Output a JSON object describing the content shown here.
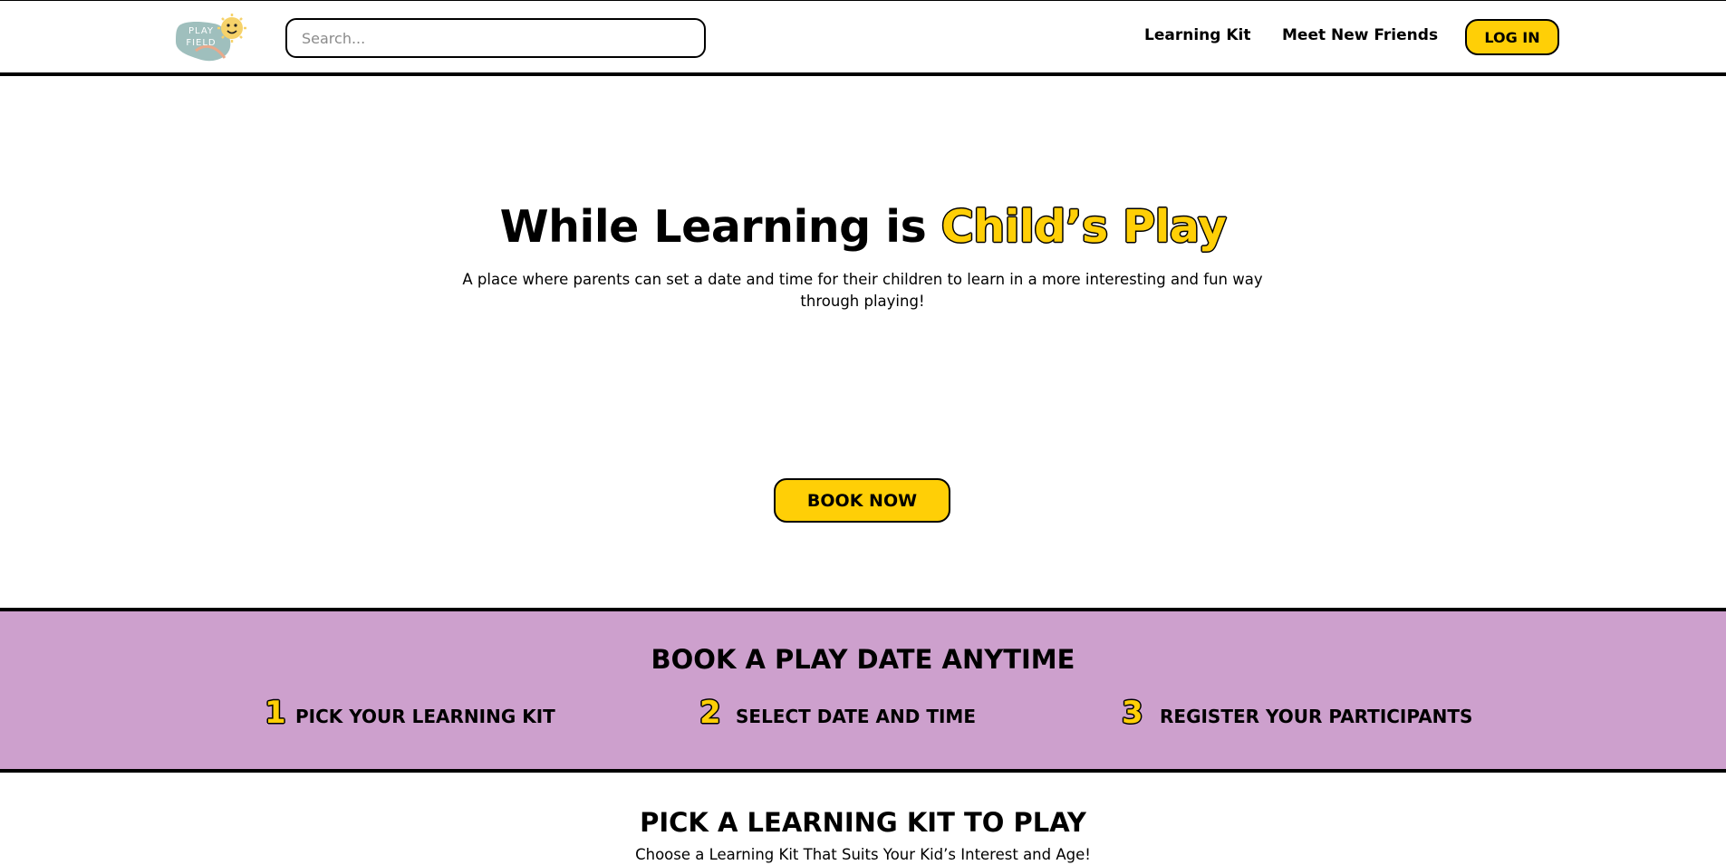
{
  "navbar": {
    "logo_text": "PLAY FIELD",
    "search_placeholder": "Search...",
    "links": [
      "Learning Kit",
      "Meet New Friends"
    ],
    "login_label": "LOG IN"
  },
  "hero": {
    "title_main": "While Learning is ",
    "title_highlight": "Child’s Play",
    "subtitle": "A place where parents can set a date and time for their children to learn in a more interesting and fun way through playing!",
    "cta_label": "BOOK NOW"
  },
  "booking": {
    "title": "BOOK A PLAY DATE ANYTIME",
    "steps": [
      {
        "number": "1",
        "label": "PICK YOUR LEARNING KIT"
      },
      {
        "number": "2",
        "label": "SELECT DATE AND TIME"
      },
      {
        "number": "3",
        "label": "REGISTER YOUR PARTICIPANTS"
      }
    ]
  },
  "kits": {
    "title": "PICK A LEARNING KIT TO PLAY",
    "subtitle": "Choose a Learning Kit That Suits Your Kid’s Interest and Age!"
  },
  "colors": {
    "accent_yellow": "#ffcf06",
    "band_purple": "#cda0cd",
    "logo_teal": "#9fbfbd"
  }
}
